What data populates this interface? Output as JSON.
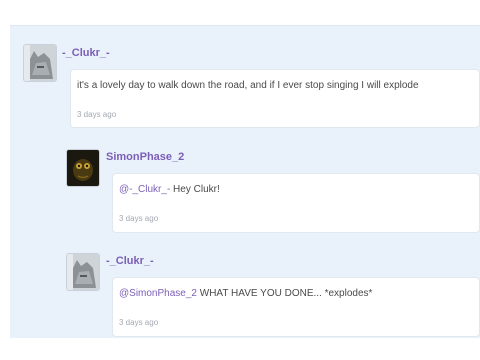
{
  "comments": [
    {
      "username": "-_Clukr_-",
      "message": "it's a lovely day to walk down the road, and if I ever stop singing I will explode",
      "time": "3 days ago"
    },
    {
      "username": "SimonPhase_2",
      "mention": "@-_Clukr_-",
      "message": " Hey Clukr!",
      "time": "3 days ago"
    },
    {
      "username": "-_Clukr_-",
      "mention": "@SimonPhase_2",
      "message": " WHAT HAVE YOU DONE... *explodes*",
      "time": "3 days ago"
    }
  ]
}
